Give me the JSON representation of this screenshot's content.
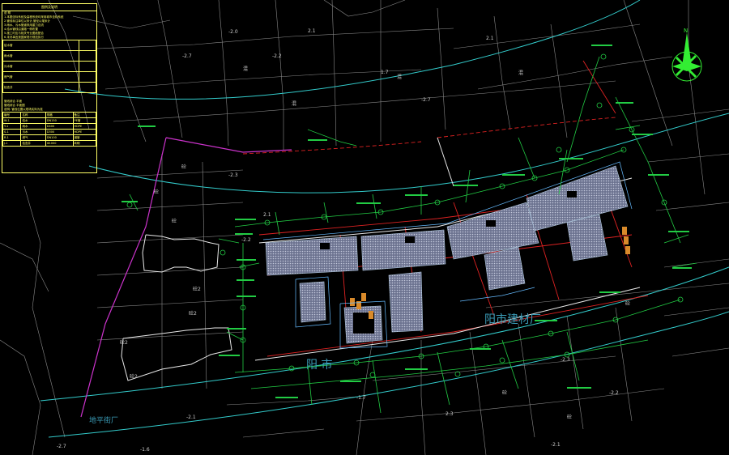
{
  "legend": {
    "title": "图例及说明",
    "notes": [
      "说 明",
      "1.本图坐标系统及高程系统均采用城市坐标系统",
      "2.管线标注单位以米计,管径以毫米计",
      "3.雨水、污水管道采用重力自流",
      "4.给水管线沿道路一侧布置",
      "5.施工时应与相关专业图纸配合",
      "6.未尽事宜按国家现行规范执行"
    ],
    "rows": [
      [
        "给水管",
        ""
      ],
      [
        "雨水管",
        ""
      ],
      [
        "污水管",
        ""
      ],
      [
        "燃气管",
        ""
      ],
      [
        "检查井",
        ""
      ]
    ],
    "section_lines": [
      "管线综合 平面",
      "管线综合 平面图",
      "说明: 管线位置以现场实际为准"
    ],
    "table_head": [
      "编号",
      "名称",
      "规格",
      "备注"
    ],
    "table_rows": [
      [
        "W-1",
        "给水",
        "DN150",
        "PE管"
      ],
      [
        "Y-1",
        "雨水",
        "D400",
        "HDPE"
      ],
      [
        "S-1",
        "污水",
        "D300",
        "HDPE"
      ],
      [
        "R-1",
        "燃气",
        "DN100",
        "钢管"
      ],
      [
        "J-1",
        "检查井",
        "Φ1000",
        "砖砌"
      ]
    ]
  },
  "place_labels": {
    "factory_east": "阳市建材厂",
    "factory_south": "地平街厂",
    "center_mark": "阳 市"
  },
  "building_labels": [
    "砼2",
    "砼2",
    "砼2",
    "砼2",
    "砼",
    "砼",
    "砼",
    "混",
    "混",
    "混",
    "混",
    "砼",
    "砼",
    "砼"
  ],
  "elevations": [
    "-2.0",
    "-2.3",
    "-2.2",
    "2.1",
    "2.1",
    "1.7",
    "-2.2",
    "-2.7",
    "-2.7",
    "2.1",
    "-2.3",
    "-2.2",
    "-1.7",
    "-2.1",
    "-2.7",
    "2.3",
    "-2.1",
    "-1.6"
  ],
  "compass_label": "N",
  "colors": {
    "cyan_road": "#33cccc",
    "green_pipe": "#22cc44",
    "red_line": "#dd2222",
    "magenta_boundary": "#cc33cc",
    "white_outline": "#e8e8e8",
    "gray_parcel": "#9a9a9a",
    "hatch_fill": "#7f86a0",
    "yellow_legend": "#ffff66"
  }
}
